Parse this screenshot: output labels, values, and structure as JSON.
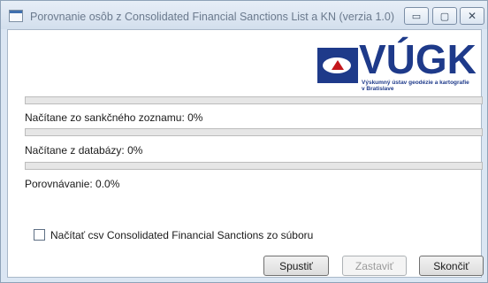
{
  "window": {
    "title": "Porovnanie osôb z Consolidated Financial Sanctions List a KN (verzia 1.0)",
    "controls": {
      "minimize": "▭",
      "maximize": "▢",
      "close": "✕"
    }
  },
  "logo": {
    "name": "VÚGK",
    "subtitle_line1": "Výskumný ústav geodézie a kartografie",
    "subtitle_line2": "v Bratislave"
  },
  "progress": [
    {
      "label": "Načítane zo sankčného zoznamu: 0%",
      "value": 0
    },
    {
      "label": "Načítane z databázy: 0%",
      "value": 0
    },
    {
      "label": "Porovnávanie: 0.0%",
      "value": 0
    }
  ],
  "options": {
    "load_csv_label": "Načítať csv Consolidated Financial Sanctions zo súboru",
    "load_csv_checked": false
  },
  "buttons": {
    "start": "Spustiť",
    "stop": "Zastaviť",
    "exit": "Skončiť"
  },
  "colors": {
    "progress_fill": "#06b025",
    "logo_blue": "#1e3a8a",
    "logo_red": "#c4161c"
  }
}
